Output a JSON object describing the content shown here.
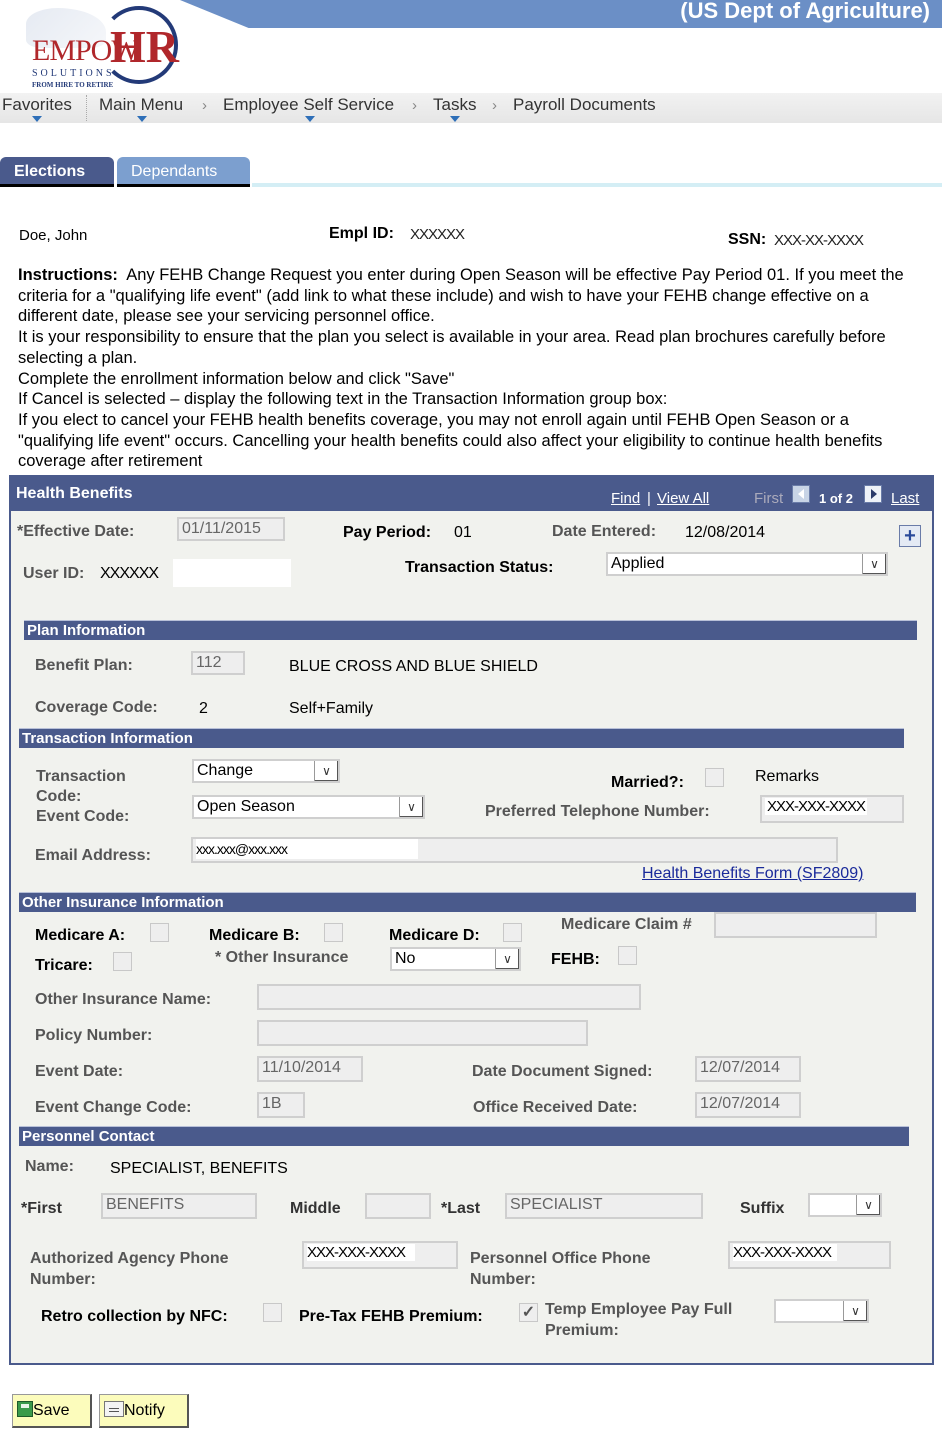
{
  "header": {
    "org_title": "(US Dept of Agriculture)",
    "logo": {
      "brand_left": "EMPOW",
      "brand_right": "HR",
      "subtitle": "SOLUTIONS",
      "tagline": "FROM HIRE TO RETIRE"
    }
  },
  "nav": {
    "favorites": "Favorites",
    "breadcrumb": [
      "Main Menu",
      "Employee Self Service",
      "Tasks",
      "Payroll Documents"
    ],
    "separator": "›"
  },
  "tabs": [
    {
      "label": "Elections",
      "active": true
    },
    {
      "label": "Dependants",
      "active": false
    }
  ],
  "employee": {
    "name": "Doe, John",
    "empl_id_label": "Empl ID:",
    "empl_id": "XXXXXX",
    "ssn_label": "SSN:",
    "ssn": "XXX-XX-XXXX"
  },
  "instructions": {
    "label": "Instructions:",
    "lines": [
      "Any FEHB Change Request you enter during Open Season will be effective Pay Period 01. If you meet the criteria for a \"qualifying life event\" (add link to what these include) and wish to have your FEHB change effective on a different date, please see your servicing personnel office.",
      "It is your responsibility to ensure that the plan you select is available in your area. Read plan brochures carefully before selecting a plan.",
      "Complete the enrollment information below and click \"Save\"",
      "If Cancel is selected – display the following text in the Transaction Information group box:",
      "If you elect to cancel your FEHB health benefits coverage, you may not enroll again until FEHB Open Season or a \"qualifying life event\" occurs. Cancelling your health benefits could also affect your eligibility to continue health benefits coverage after retirement"
    ]
  },
  "health_benefits": {
    "title": "Health Benefits",
    "find": "Find",
    "view_all": "View All",
    "separator": "|",
    "first": "First",
    "count": "1 of 2",
    "last": "Last",
    "add_icon": "+",
    "effective_date_label": "*Effective Date:",
    "effective_date": "01/11/2015",
    "pay_period_label": "Pay Period:",
    "pay_period": "01",
    "date_entered_label": "Date Entered:",
    "date_entered": "12/08/2014",
    "user_id_label": "User ID:",
    "user_id": "XXXXXX",
    "transaction_status_label": "Transaction Status:",
    "transaction_status": "Applied"
  },
  "plan_info": {
    "title": "Plan Information",
    "benefit_plan_label": "Benefit Plan:",
    "benefit_plan": "112",
    "benefit_plan_name": "BLUE CROSS AND BLUE SHIELD",
    "coverage_code_label": "Coverage Code:",
    "coverage_code": "2",
    "coverage_desc": "Self+Family"
  },
  "transaction_info": {
    "title": "Transaction Information",
    "transaction_code_label": "Transaction Code:",
    "transaction_code": "Change",
    "event_code_label": "Event Code:",
    "event_code": "Open Season",
    "married_label": "Married?:",
    "married": false,
    "remarks_label": "Remarks",
    "phone_label": "Preferred Telephone Number:",
    "phone": "XXX-XXX-XXXX",
    "email_label": "Email Address:",
    "email": "xxx.xxx@xxx.xxx",
    "form_link": "Health Benefits Form (SF2809)"
  },
  "other_insurance": {
    "title": "Other Insurance Information",
    "medicare_a_label": "Medicare A:",
    "medicare_b_label": "Medicare B:",
    "medicare_d_label": "Medicare D:",
    "medicare_claim_label": "Medicare Claim #",
    "medicare_claim": "",
    "tricare_label": "Tricare:",
    "other_insurance_label": "* Other Insurance",
    "other_insurance": "No",
    "fehb_label": "FEHB:",
    "other_insurance_name_label": "Other Insurance Name:",
    "other_insurance_name": "",
    "policy_number_label": "Policy Number:",
    "policy_number": "",
    "event_date_label": "Event Date:",
    "event_date": "11/10/2014",
    "date_signed_label": "Date Document Signed:",
    "date_signed": "12/07/2014",
    "event_change_code_label": "Event Change Code:",
    "event_change_code": "1B",
    "office_received_label": "Office Received Date:",
    "office_received": "12/07/2014"
  },
  "personnel_contact": {
    "title": "Personnel Contact",
    "name_label": "Name:",
    "name": "SPECIALIST, BENEFITS",
    "first_label": "*First",
    "first": "BENEFITS",
    "middle_label": "Middle",
    "middle": "",
    "last_label": "*Last",
    "last": "SPECIALIST",
    "suffix_label": "Suffix",
    "suffix": "",
    "agency_phone_label_1": "Authorized Agency Phone",
    "agency_phone_label_2": "Number:",
    "agency_phone": "XXX-XXX-XXXX",
    "office_phone_label_1": "Personnel Office Phone",
    "office_phone_label_2": "Number:",
    "office_phone": "XXX-XXX-XXXX",
    "retro_label": "Retro collection by NFC:",
    "retro": false,
    "pretax_label": "Pre-Tax FEHB Premium:",
    "pretax": true,
    "temp_label_1": "Temp Employee Pay Full",
    "temp_label_2": "Premium:",
    "temp": ""
  },
  "buttons": {
    "save": "Save",
    "notify": "Notify"
  },
  "colors": {
    "header_bar": "#4a5a8c",
    "tab_inactive": "#7c9fcf",
    "banner": "#6b8fc6",
    "panel_bg": "#f1f2ee",
    "button_bg": "#fcfcbc",
    "link": "#1a2a9a"
  }
}
